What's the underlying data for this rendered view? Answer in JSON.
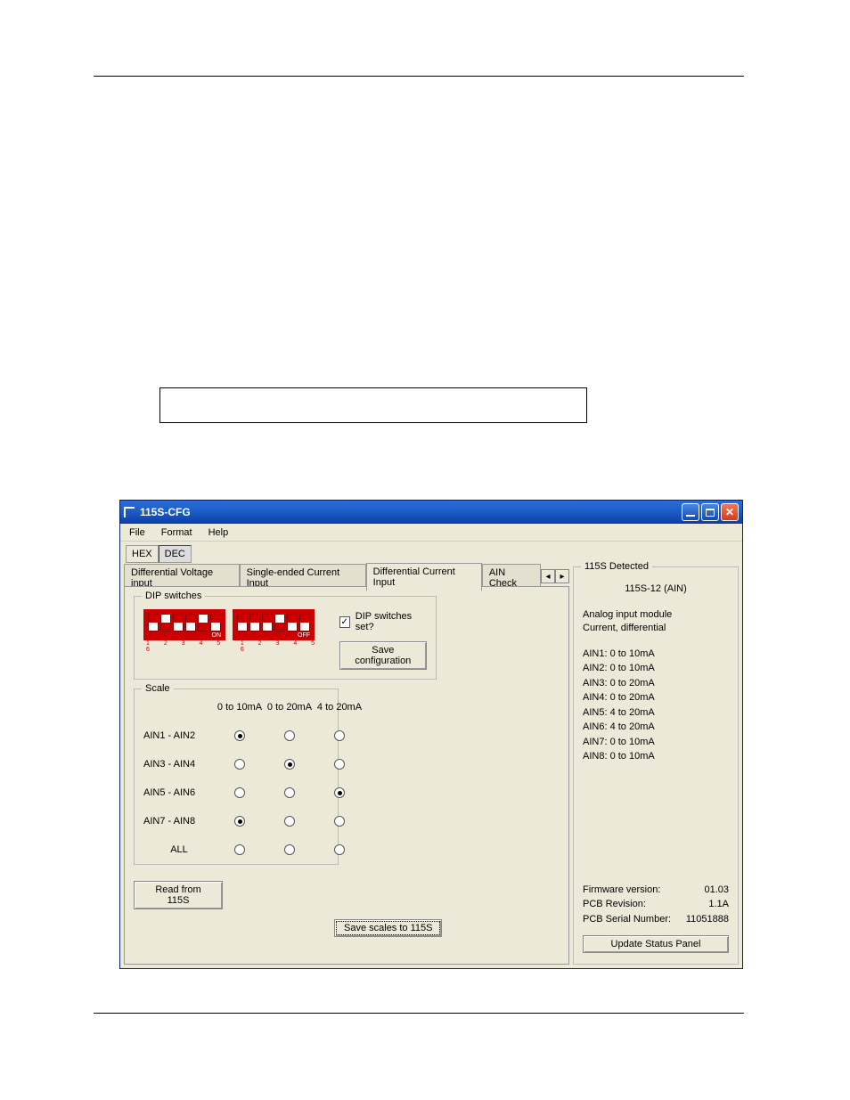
{
  "window": {
    "title": "115S-CFG"
  },
  "menu": {
    "file": "File",
    "format": "Format",
    "help": "Help"
  },
  "hexdec": {
    "hex": "HEX",
    "dec": "DEC"
  },
  "tabs": {
    "t0": "Differential Voltage input",
    "t1": "Single-ended Current Input",
    "t2": "Differential Current Input",
    "t3": "AIN Check"
  },
  "dip": {
    "legend": "DIP switches",
    "on": "ON",
    "off": "OFF",
    "nums": "1 2 3 4 5 6",
    "chk_label": "DIP switches set?",
    "save_btn": "Save configuration"
  },
  "scale": {
    "legend": "Scale",
    "h0": "0 to 10mA",
    "h1": "0 to 20mA",
    "h2": "4 to 20mA",
    "r0": "AIN1 - AIN2",
    "r1": "AIN3 - AIN4",
    "r2": "AIN5 - AIN6",
    "r3": "AIN7 - AIN8",
    "r4": "ALL",
    "save_btn": "Save scales to 115S",
    "read_btn": "Read from 115S"
  },
  "detected": {
    "legend": "115S Detected",
    "title": "115S-12 (AIN)",
    "desc1": "Analog input module",
    "desc2": "Current, differential",
    "ain": {
      "a1": "AIN1: 0 to 10mA",
      "a2": "AIN2: 0 to 10mA",
      "a3": "AIN3: 0 to 20mA",
      "a4": "AIN4: 0 to 20mA",
      "a5": "AIN5: 4 to 20mA",
      "a6": "AIN6: 4 to 20mA",
      "a7": "AIN7: 0 to 10mA",
      "a8": "AIN8: 0 to 10mA"
    },
    "fw_label": "Firmware version:",
    "fw_val": "01.03",
    "pcb_label": "PCB Revision:",
    "pcb_val": "1.1A",
    "sn_label": "PCB Serial Number:",
    "sn_val": "11051888",
    "update_btn": "Update Status Panel"
  }
}
